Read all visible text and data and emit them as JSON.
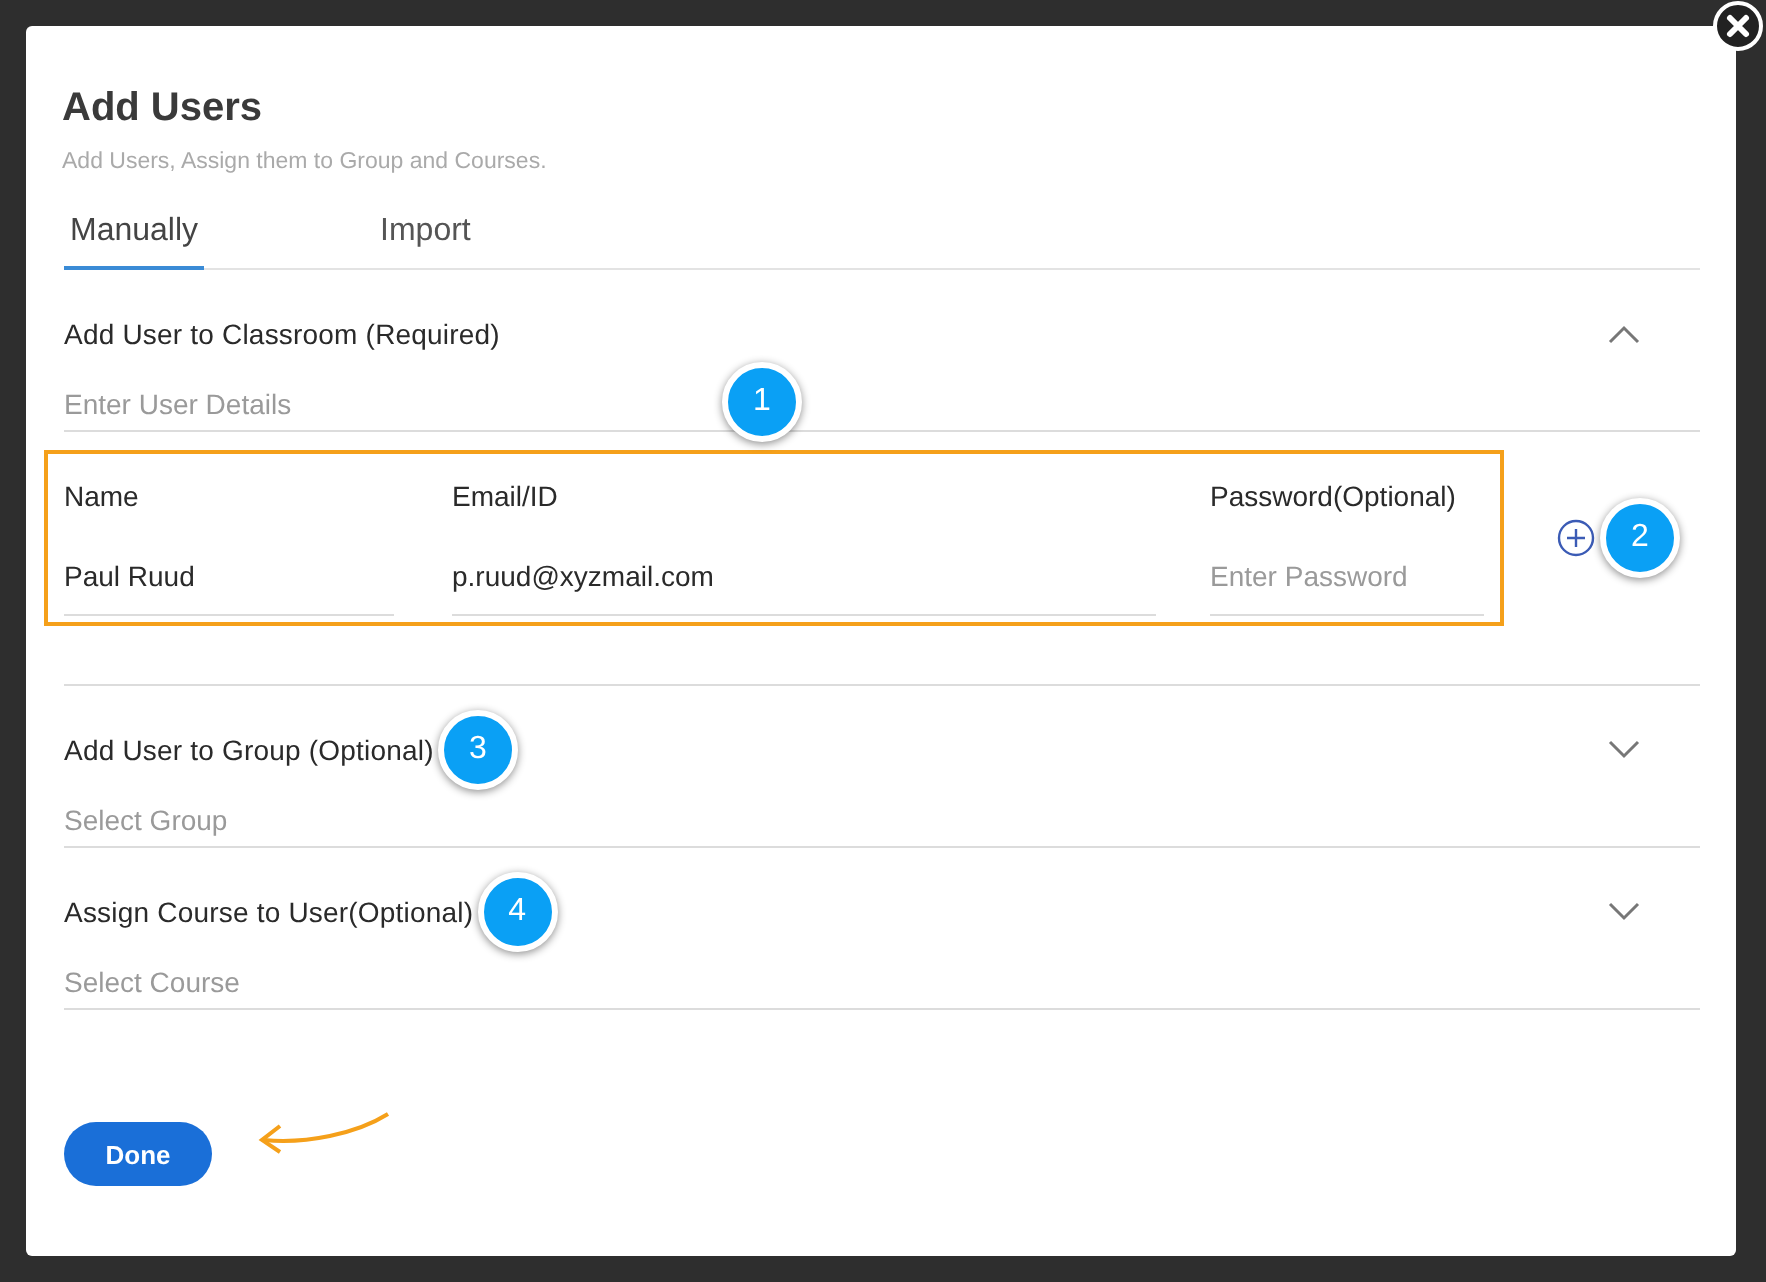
{
  "dialog": {
    "title": "Add Users",
    "subtitle": "Add Users, Assign them to Group and Courses."
  },
  "tabs": [
    {
      "label": "Manually",
      "selected": true
    },
    {
      "label": "Import",
      "selected": false
    }
  ],
  "sections": [
    {
      "kind": "users",
      "title": "Add User to Classroom (Required)",
      "expanded": true,
      "placeholder": "Enter User Details",
      "callout": "1",
      "columns": [
        "Name",
        "Email/ID",
        "Password(Optional)"
      ],
      "rows": [
        {
          "name": "Paul Ruud",
          "email": "p.ruud@xyzmail.com",
          "password_placeholder": "Enter Password"
        }
      ],
      "add_callout": "2"
    },
    {
      "kind": "select",
      "title": "Add User to Group (Optional)",
      "expanded": false,
      "placeholder": "Select Group",
      "callout": "3"
    },
    {
      "kind": "select",
      "title": "Assign Course to User(Optional)",
      "expanded": false,
      "placeholder": "Select Course",
      "callout": "4"
    }
  ],
  "done_button": {
    "label": "Done"
  }
}
